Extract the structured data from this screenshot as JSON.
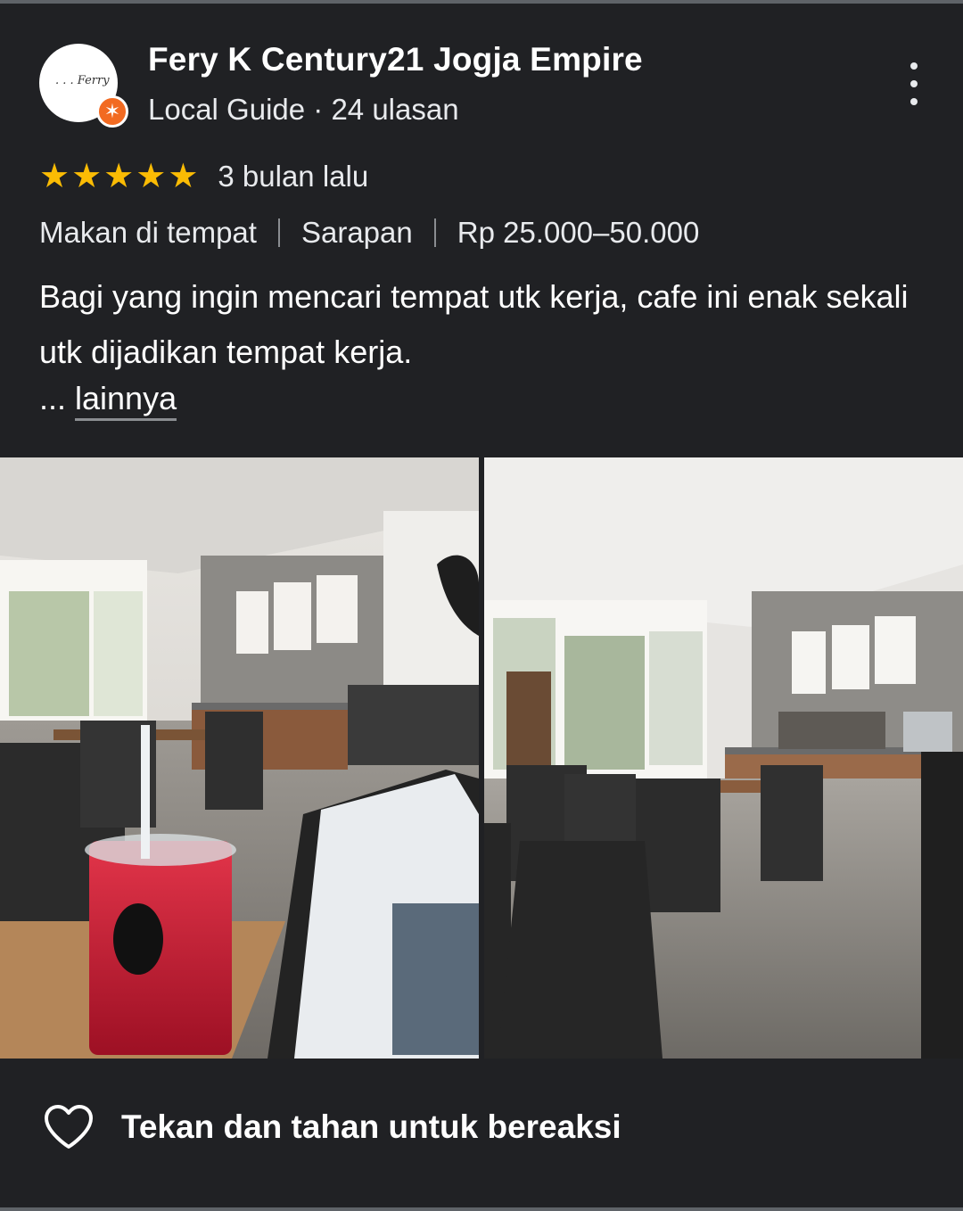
{
  "review": {
    "author_name": "Fery K Century21 Jogja Empire",
    "author_meta": "Local Guide · 24 ulasan",
    "avatar_text": ". . . Ferry",
    "rating": 5,
    "time_ago": "3 bulan lalu",
    "tags": [
      "Makan di tempat",
      "Sarapan",
      "Rp 25.000–50.000"
    ],
    "text": "Bagi yang ingin mencari tempat utk kerja, cafe ini enak sekali utk dijadikan tempat kerja.",
    "more_prefix": "... ",
    "more_label": "lainnya"
  },
  "photos": [
    {
      "name": "photo-cafe-drink-tablet"
    },
    {
      "name": "photo-cafe-interior"
    }
  ],
  "reaction": {
    "label": "Tekan dan tahan untuk bereaksi"
  },
  "icons": {
    "more": "more-vert-icon",
    "heart": "heart-outline-icon",
    "star": "star-icon",
    "badge": "local-guide-badge-icon"
  },
  "colors": {
    "background": "#202124",
    "star": "#fbbc04",
    "badge": "#f26a21",
    "text": "#e8eaed"
  }
}
